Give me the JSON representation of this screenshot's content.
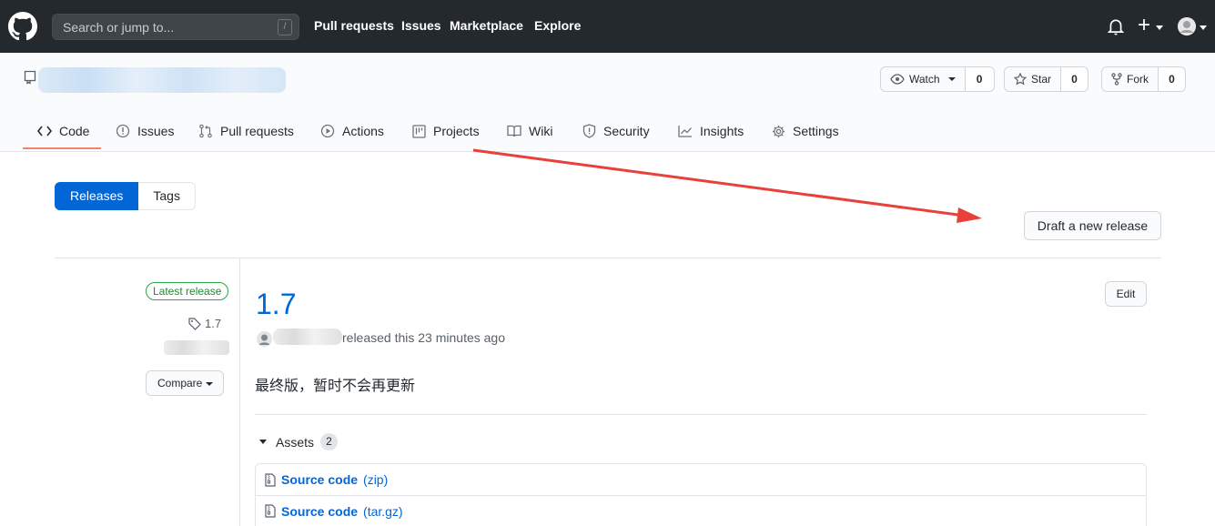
{
  "header": {
    "search_placeholder": "Search or jump to...",
    "search_shortcut": "/",
    "nav": [
      "Pull requests",
      "Issues",
      "Marketplace",
      "Explore"
    ]
  },
  "repo": {
    "actions": {
      "watch_label": "Watch",
      "watch_count": "0",
      "star_label": "Star",
      "star_count": "0",
      "fork_label": "Fork",
      "fork_count": "0"
    },
    "tabs": [
      {
        "label": "Code",
        "icon": "code-icon",
        "selected": true
      },
      {
        "label": "Issues",
        "icon": "issue-icon"
      },
      {
        "label": "Pull requests",
        "icon": "pull-request-icon"
      },
      {
        "label": "Actions",
        "icon": "play-icon"
      },
      {
        "label": "Projects",
        "icon": "project-icon"
      },
      {
        "label": "Wiki",
        "icon": "book-icon"
      },
      {
        "label": "Security",
        "icon": "shield-icon"
      },
      {
        "label": "Insights",
        "icon": "graph-icon"
      },
      {
        "label": "Settings",
        "icon": "gear-icon"
      }
    ]
  },
  "subnav": {
    "releases_label": "Releases",
    "tags_label": "Tags",
    "selected": "Releases"
  },
  "draft_button_label": "Draft a new release",
  "release": {
    "latest_badge": "Latest release",
    "tag": "1.7",
    "compare_label": "Compare",
    "title": "1.7",
    "edit_label": "Edit",
    "released_text": "released this 23 minutes ago",
    "notes": "最终版，暂时不会再更新",
    "assets_label": "Assets",
    "assets_count": "2",
    "assets": [
      {
        "name": "Source code",
        "ext": "(zip)"
      },
      {
        "name": "Source code",
        "ext": "(tar.gz)"
      }
    ]
  },
  "colors": {
    "header_bg": "#24292e",
    "link_blue": "#0366d6",
    "primary_blue": "#0366d6",
    "latest_green": "#28a745",
    "tab_underline": "#f9826c",
    "annotation_arrow": "#e8403a"
  }
}
